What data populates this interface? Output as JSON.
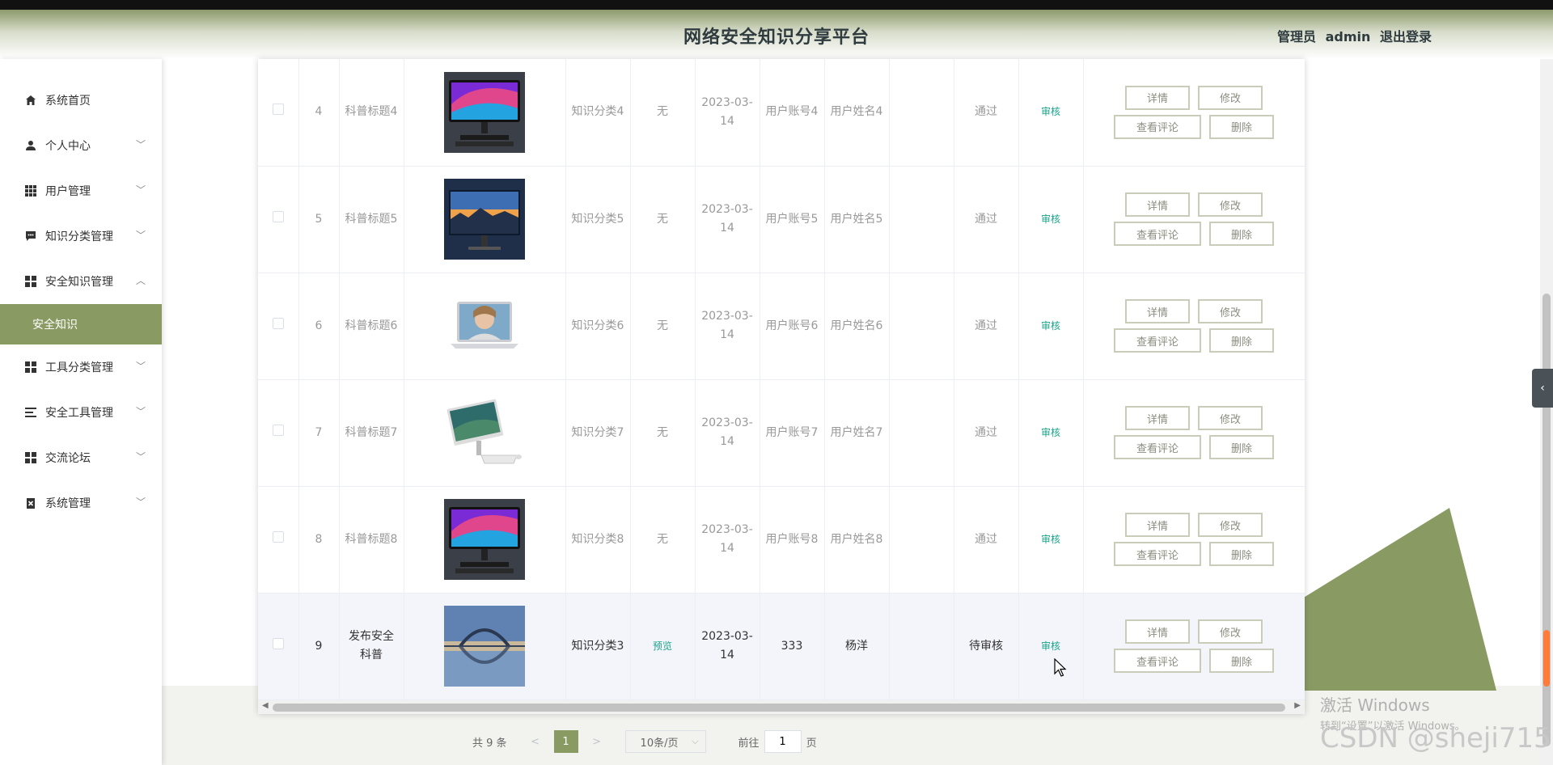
{
  "header": {
    "title": "网络安全知识分享平台",
    "role": "管理员",
    "username": "admin",
    "logout": "退出登录"
  },
  "sidebar": {
    "items": [
      {
        "label": "系统首页",
        "icon": "home-icon"
      },
      {
        "label": "个人中心",
        "icon": "person-icon"
      },
      {
        "label": "用户管理",
        "icon": "grid-icon"
      },
      {
        "label": "知识分类管理",
        "icon": "chat-icon"
      },
      {
        "label": "安全知识管理",
        "icon": "grid-icon"
      },
      {
        "label": "工具分类管理",
        "icon": "grid-icon"
      },
      {
        "label": "安全工具管理",
        "icon": "list-icon"
      },
      {
        "label": "交流论坛",
        "icon": "grid-icon"
      },
      {
        "label": "系统管理",
        "icon": "clipboard-icon"
      }
    ],
    "active_sub": "安全知识"
  },
  "table": {
    "rows": [
      {
        "index": "4",
        "title": "科普标题4",
        "image": "monitor-curved",
        "category": "知识分类4",
        "preview": "无",
        "date": "2023-03-14",
        "account": "用户账号4",
        "name": "用户姓名4",
        "status": "通过",
        "review": "审核"
      },
      {
        "index": "5",
        "title": "科普标题5",
        "image": "monitor-city",
        "category": "知识分类5",
        "preview": "无",
        "date": "2023-03-14",
        "account": "用户账号5",
        "name": "用户姓名5",
        "status": "通过",
        "review": "审核"
      },
      {
        "index": "6",
        "title": "科普标题6",
        "image": "laptop",
        "category": "知识分类6",
        "preview": "无",
        "date": "2023-03-14",
        "account": "用户账号6",
        "name": "用户姓名6",
        "status": "通过",
        "review": "审核"
      },
      {
        "index": "7",
        "title": "科普标题7",
        "image": "all-in-one",
        "category": "知识分类7",
        "preview": "无",
        "date": "2023-03-14",
        "account": "用户账号7",
        "name": "用户姓名7",
        "status": "通过",
        "review": "审核"
      },
      {
        "index": "8",
        "title": "科普标题8",
        "image": "monitor-curved",
        "category": "知识分类8",
        "preview": "无",
        "date": "2023-03-14",
        "account": "用户账号8",
        "name": "用户姓名8",
        "status": "通过",
        "review": "审核"
      },
      {
        "index": "9",
        "title": "发布安全科普",
        "image": "bridge-reflection",
        "category": "知识分类3",
        "preview": "预览",
        "date": "2023-03-14",
        "account": "333",
        "name": "杨洋",
        "status": "待审核",
        "review": "审核"
      }
    ],
    "actions": {
      "detail": "详情",
      "edit": "修改",
      "comments": "查看评论",
      "delete": "删除"
    }
  },
  "pagination": {
    "total": "共 9 条",
    "current": "1",
    "page_size": "10条/页",
    "goto_label": "前往",
    "goto_value": "1",
    "page_suffix": "页",
    "prev": "<",
    "next": ">"
  },
  "overlay": {
    "activate_title": "激活 Windows",
    "activate_sub": "转到“设置”以激活 Windows。",
    "csdn": "CSDN @sheji715"
  },
  "colors": {
    "accent": "#8a9a63",
    "link": "#1aa38a"
  }
}
